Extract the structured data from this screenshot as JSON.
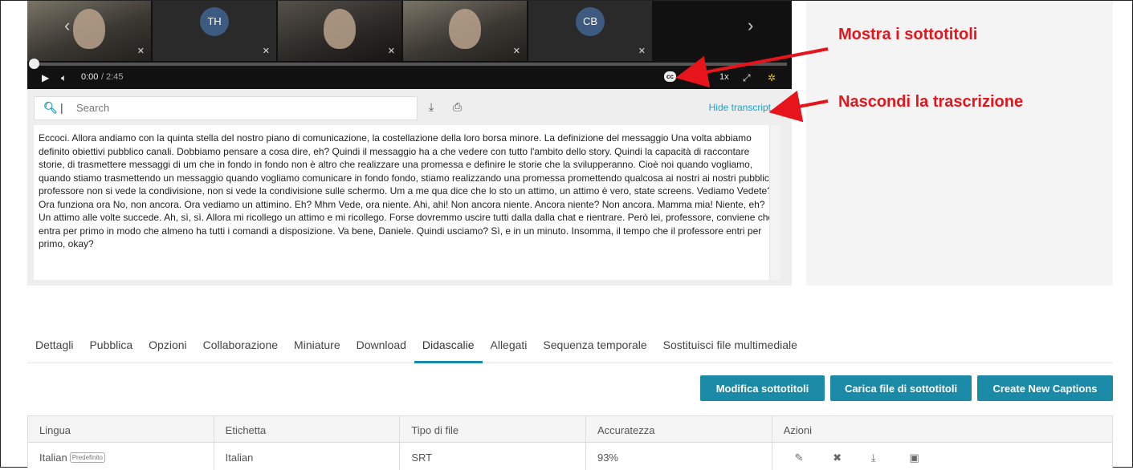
{
  "player": {
    "thumbs": [
      {
        "initials": ""
      },
      {
        "initials": "TH"
      },
      {
        "initials": ""
      },
      {
        "initials": ""
      },
      {
        "initials": "CB"
      }
    ],
    "time_current": "0:00",
    "time_total": "/ 2:45",
    "speed": "1x",
    "progress": 0
  },
  "transcript": {
    "search_placeholder": "Search",
    "hide_label": "Hide transcript",
    "text": "Eccoci. Allora andiamo con la quinta stella del nostro piano di comunicazione, la costellazione della loro borsa minore. La definizione del messaggio Una volta abbiamo definito obiettivi pubblico canali. Dobbiamo pensare a cosa dire, eh? Quindi il messaggio ha a che vedere con tutto l'ambito dello story. Quindi la capacità di raccontare storie, di trasmettere messaggi di um che in fondo in fondo non è altro che realizzare una promessa e definire le storie che la svilupperanno. Cioè noi quando vogliamo, quando stiamo trasmettendo un messaggio quando vogliamo comunicare in fondo fondo, stiamo realizzando una promessa promettendo qualcosa ai nostri ai nostri pubblici professore non si vede la condivisione, non si vede la condivisione sulle schermo. Um a me qua dice che lo sto un attimo, un attimo è vero, state screens. Vediamo Vedete? Ora funziona ora No, non ancora. Ora vediamo un attimino. Eh? Mhm Vede, ora niente. Ahi, ahi! Non ancora niente. Ancora niente? Non ancora. Mamma mia! Niente, eh? Un attimo alle volte succede. Ah, sì, sì. Allora mi ricollego un attimo e mi ricollego. Forse dovremmo uscire tutti dalla dalla chat e rientrare. Però lei, professore, conviene che entra per primo in modo che almeno ha tutti i comandi a disposizione. Va bene, Daniele. Quindi usciamo? Sì, e in un minuto. Insomma, il tempo che il professore entri per primo, okay?"
  },
  "annotations": {
    "show_captions": "Mostra i sottotitoli",
    "hide_transcript": "Nascondi la trascrizione",
    "color": "#e8141c"
  },
  "tabs": [
    {
      "label": "Dettagli"
    },
    {
      "label": "Pubblica"
    },
    {
      "label": "Opzioni"
    },
    {
      "label": "Collaborazione"
    },
    {
      "label": "Miniature"
    },
    {
      "label": "Download"
    },
    {
      "label": "Didascalie",
      "active": true
    },
    {
      "label": "Allegati"
    },
    {
      "label": "Sequenza temporale"
    },
    {
      "label": "Sostituisci file multimediale"
    }
  ],
  "buttons": {
    "edit": "Modifica sottotitoli",
    "upload": "Carica file di sottotitoli",
    "create": "Create New Captions"
  },
  "table": {
    "headers": [
      "Lingua",
      "Etichetta",
      "Tipo di file",
      "Accuratezza",
      "Azioni"
    ],
    "rows": [
      {
        "language": "Italian",
        "default_badge": "Predefinito",
        "label": "Italian",
        "file_type": "SRT",
        "accuracy": "93%"
      }
    ]
  },
  "colors": {
    "accent": "#1a8aa7",
    "link": "#1aa3c8"
  }
}
